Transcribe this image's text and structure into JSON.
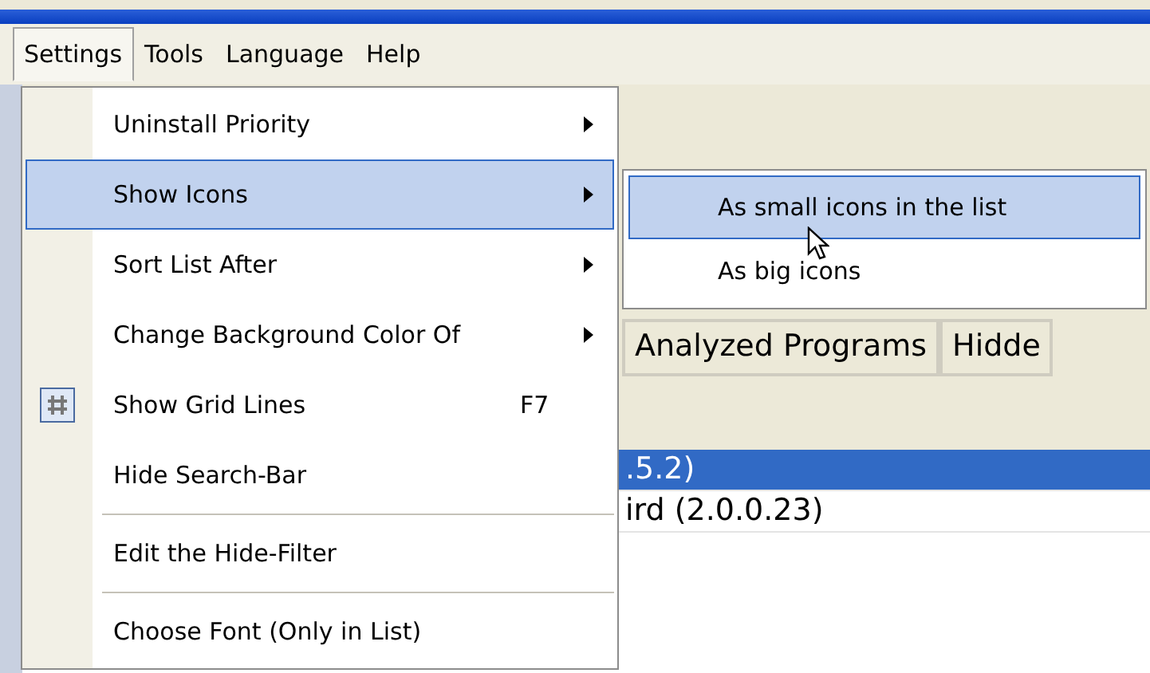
{
  "menubar": [
    {
      "label": "Settings",
      "selected": true
    },
    {
      "label": "Tools",
      "selected": false
    },
    {
      "label": "Language",
      "selected": false
    },
    {
      "label": "Help",
      "selected": false
    }
  ],
  "settings_menu": [
    {
      "kind": "item",
      "label": "Uninstall Priority",
      "submenu": true,
      "selected": false,
      "checked": false
    },
    {
      "kind": "item",
      "label": "Show Icons",
      "submenu": true,
      "selected": true,
      "checked": false
    },
    {
      "kind": "item",
      "label": "Sort List After",
      "submenu": true,
      "selected": false,
      "checked": false
    },
    {
      "kind": "item",
      "label": "Change Background Color Of",
      "submenu": true,
      "selected": false,
      "checked": false
    },
    {
      "kind": "item",
      "label": "Show Grid Lines",
      "shortcut": "F7",
      "submenu": false,
      "selected": false,
      "checked": true
    },
    {
      "kind": "item",
      "label": "Hide Search-Bar",
      "submenu": false,
      "selected": false,
      "checked": false
    },
    {
      "kind": "separator"
    },
    {
      "kind": "item",
      "label": "Edit the Hide-Filter",
      "submenu": false,
      "selected": false,
      "checked": false
    },
    {
      "kind": "separator"
    },
    {
      "kind": "item",
      "label": "Choose Font (Only in List)",
      "submenu": false,
      "selected": false,
      "checked": false
    }
  ],
  "show_icons_submenu": [
    {
      "label": "As small icons in the list",
      "selected": true
    },
    {
      "label": "As big icons",
      "selected": false
    }
  ],
  "tabs": [
    {
      "label": "Analyzed Programs"
    },
    {
      "label": "Hidde"
    }
  ],
  "program_list": [
    {
      "text": ".5.2)",
      "selected": true
    },
    {
      "text": "ird (2.0.0.23)",
      "selected": false
    }
  ]
}
